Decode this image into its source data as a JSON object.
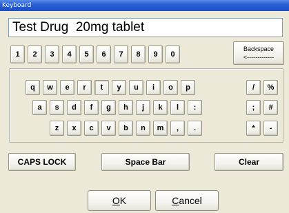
{
  "window": {
    "title": "Keyboard"
  },
  "display": {
    "value": "Test Drug  20mg tablet"
  },
  "number_row": [
    "1",
    "2",
    "3",
    "4",
    "5",
    "6",
    "7",
    "8",
    "9",
    "0"
  ],
  "backspace": {
    "line1": "Backspace",
    "line2": "<-------------"
  },
  "row1": [
    "q",
    "w",
    "e",
    "r",
    "t",
    "y",
    "u",
    "i",
    "o",
    "p",
    "/",
    "%"
  ],
  "row2": [
    "a",
    "s",
    "d",
    "f",
    "g",
    "h",
    "j",
    "k",
    "l",
    ":",
    ";",
    "#"
  ],
  "row3": [
    "z",
    "x",
    "c",
    "v",
    "b",
    "n",
    "m",
    ",",
    ".",
    "*",
    "-"
  ],
  "bottom": {
    "caps_lock": "CAPS LOCK",
    "space_bar": "Space Bar",
    "clear": "Clear"
  },
  "dialog": {
    "ok_mnemonic": "O",
    "ok_rest": "K",
    "cancel_mnemonic": "C",
    "cancel_rest": "ancel"
  }
}
